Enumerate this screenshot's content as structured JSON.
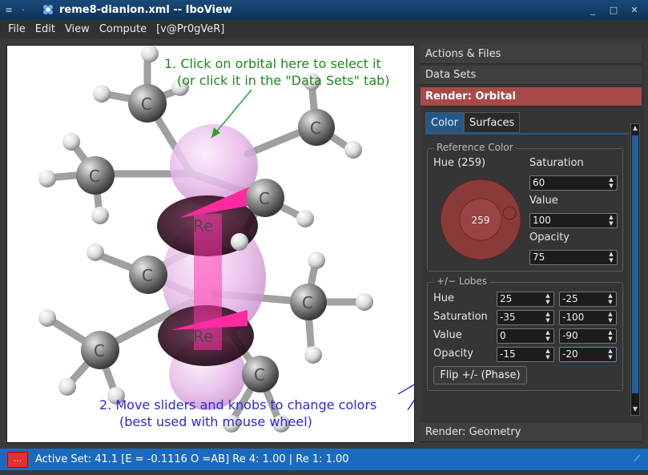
{
  "window": {
    "title": "reme8-dianion.xml -- IboView",
    "menu_icon": "hamburger-icon",
    "controls": [
      "minimize-icon",
      "maximize-icon",
      "close-icon"
    ]
  },
  "menu": [
    "File",
    "Edit",
    "View",
    "Compute",
    "[v@Pr0gVeR]"
  ],
  "viewport": {
    "annotation_1_line1": "1. Click on orbital here to select it",
    "annotation_1_line2": "(or click it in the \"Data Sets\" tab)",
    "annotation_2_line1": "2. Move sliders and knobs to change colors",
    "annotation_2_line2": "(best used with mouse wheel)",
    "atom_labels": [
      "C",
      "C",
      "C",
      "C",
      "Re",
      "C",
      "C",
      "C",
      "Re",
      "C"
    ]
  },
  "panel": {
    "sections": {
      "actions": "Actions & Files",
      "datasets": "Data Sets",
      "render_orbital": "Render: Orbital",
      "render_geometry": "Render: Geometry"
    },
    "tabs": [
      "Color",
      "Surfaces"
    ],
    "reference_color": {
      "title": "Reference Color",
      "hue_label": "Hue (259)",
      "hue_knob_value": "259",
      "saturation_label": "Saturation",
      "saturation_value": "60",
      "value_label": "Value",
      "value_value": "100",
      "opacity_label": "Opacity",
      "opacity_value": "75",
      "accent_color": "#8b3a3a"
    },
    "lobes": {
      "title": "+/− Lobes",
      "rows": [
        {
          "label": "Hue",
          "plus": "25",
          "minus": "-25"
        },
        {
          "label": "Saturation",
          "plus": "-35",
          "minus": "-100"
        },
        {
          "label": "Value",
          "plus": "0",
          "minus": "-90"
        },
        {
          "label": "Opacity",
          "plus": "-15",
          "minus": "-20"
        }
      ],
      "flip_label": "Flip +/- (Phase)"
    }
  },
  "status": {
    "button_label": "...",
    "text": "Active Set:  41.1 [E = -0.1116 O =AB]  Re 4: 1.00 | Re 1: 1.00"
  }
}
